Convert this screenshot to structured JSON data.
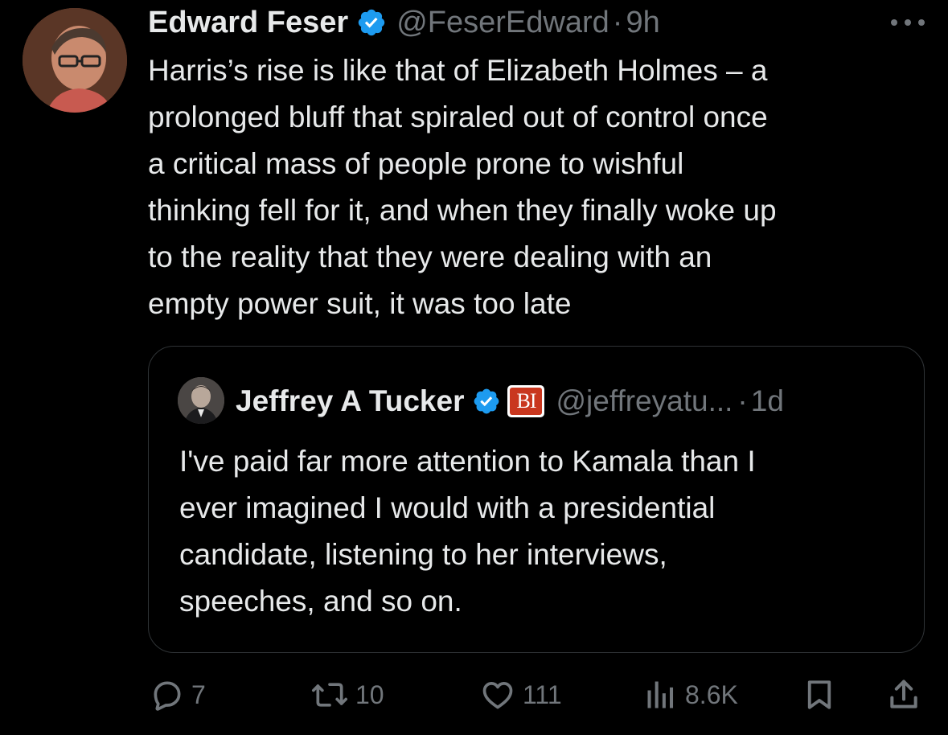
{
  "tweet": {
    "author_name": "Edward Feser",
    "author_handle": "@FeserEdward",
    "time": "9h",
    "text": "Harris’s rise is like that of Elizabeth Holmes – a\nprolonged bluff that spiraled out of control once\na critical mass of people prone to wishful\nthinking fell for it, and when they finally woke up\nto the reality that they were dealing with an\nempty power suit, it was too late"
  },
  "quote": {
    "author_name": "Jeffrey A Tucker",
    "badge_label": "BI",
    "author_handle": "@jeffreyatu...",
    "time": "1d",
    "text": "I've paid far more attention to Kamala than I\never imagined I would with a presidential\ncandidate, listening to her interviews,\nspeeches, and so on."
  },
  "actions": {
    "replies": "7",
    "reposts": "10",
    "likes": "111",
    "views": "8.6K"
  },
  "icons": {
    "verified": "verified-badge-icon",
    "more": "more-icon",
    "reply": "reply-icon",
    "repost": "repost-icon",
    "like": "heart-icon",
    "views": "views-icon",
    "bookmark": "bookmark-icon",
    "share": "share-icon"
  },
  "colors": {
    "background": "#000000",
    "text": "#e7e9ea",
    "secondary": "#71767b",
    "verified": "#1d9bf0",
    "border": "#2f3336",
    "bi_badge": "#c9371f"
  }
}
